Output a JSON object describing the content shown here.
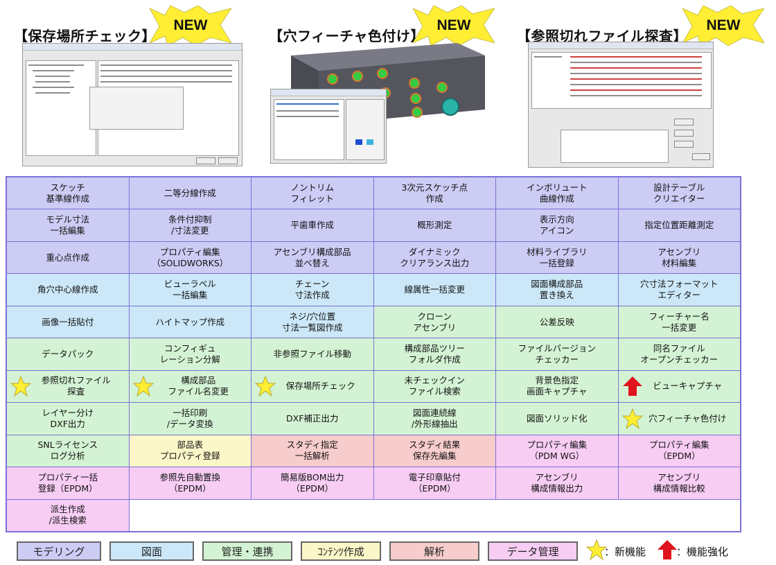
{
  "features": [
    {
      "title": "【保存場所チェック】",
      "badge": "NEW"
    },
    {
      "title": "【穴フィーチャ色付け】",
      "badge": "NEW"
    },
    {
      "title": "【参照切れファイル探査】",
      "badge": "NEW"
    }
  ],
  "cells": [
    {
      "label": "スケッチ\n基準線作成",
      "category": "modeling"
    },
    {
      "label": "二等分線作成",
      "category": "modeling"
    },
    {
      "label": "ノントリム\nフィレット",
      "category": "modeling"
    },
    {
      "label": "3次元スケッチ点\n作成",
      "category": "modeling"
    },
    {
      "label": "インボリュート\n曲線作成",
      "category": "modeling"
    },
    {
      "label": "設計テーブル\nクリエイター",
      "category": "modeling"
    },
    {
      "label": "モデル寸法\n一括編集",
      "category": "modeling"
    },
    {
      "label": "条件付抑制\n/寸法変更",
      "category": "modeling"
    },
    {
      "label": "平歯車作成",
      "category": "modeling"
    },
    {
      "label": "概形測定",
      "category": "modeling"
    },
    {
      "label": "表示方向\nアイコン",
      "category": "modeling"
    },
    {
      "label": "指定位置距離測定",
      "category": "modeling"
    },
    {
      "label": "重心点作成",
      "category": "modeling"
    },
    {
      "label": "プロパティ編集\n（SOLIDWORKS）",
      "category": "modeling"
    },
    {
      "label": "アセンブリ構成部品\n並べ替え",
      "category": "modeling"
    },
    {
      "label": "ダイナミック\nクリアランス出力",
      "category": "modeling"
    },
    {
      "label": "材料ライブラリ\n一括登録",
      "category": "modeling"
    },
    {
      "label": "アセンブリ\n材料編集",
      "category": "modeling"
    },
    {
      "label": "角穴中心線作成",
      "category": "drawing"
    },
    {
      "label": "ビューラベル\n一括編集",
      "category": "drawing"
    },
    {
      "label": "チェーン\n寸法作成",
      "category": "drawing"
    },
    {
      "label": "線属性一括変更",
      "category": "drawing"
    },
    {
      "label": "図面構成部品\n置き換え",
      "category": "drawing"
    },
    {
      "label": "穴寸法フォーマット\nエディター",
      "category": "drawing"
    },
    {
      "label": "画像一括貼付",
      "category": "drawing"
    },
    {
      "label": "ハイトマップ作成",
      "category": "drawing"
    },
    {
      "label": "ネジ/穴位置\n寸法一覧図作成",
      "category": "drawing"
    },
    {
      "label": "クローン\nアセンブリ",
      "category": "management"
    },
    {
      "label": "公差反映",
      "category": "management"
    },
    {
      "label": "フィーチャー名\n一括変更",
      "category": "management"
    },
    {
      "label": "データパック",
      "category": "management"
    },
    {
      "label": "コンフィギュ\nレーション分解",
      "category": "management"
    },
    {
      "label": "非参照ファイル移動",
      "category": "management"
    },
    {
      "label": "構成部品ツリー\nフォルダ作成",
      "category": "management"
    },
    {
      "label": "ファイルバージョン\nチェッカー",
      "category": "management"
    },
    {
      "label": "同名ファイル\nオープンチェッカー",
      "category": "management"
    },
    {
      "label": "参照切れファイル\n探査",
      "category": "management",
      "icon": "star"
    },
    {
      "label": "構成部品\nファイル名変更",
      "category": "management",
      "icon": "star"
    },
    {
      "label": "保存場所チェック",
      "category": "management",
      "icon": "star"
    },
    {
      "label": "未チェックイン\nファイル検索",
      "category": "management"
    },
    {
      "label": "背景色指定\n画面キャプチャ",
      "category": "management"
    },
    {
      "label": "ビューキャプチャ",
      "category": "management",
      "icon": "arrow"
    },
    {
      "label": "レイヤー分け\nDXF出力",
      "category": "management"
    },
    {
      "label": "一括印刷\n/データ変換",
      "category": "management"
    },
    {
      "label": "DXF補正出力",
      "category": "management"
    },
    {
      "label": "図面連続線\n/外形線抽出",
      "category": "management"
    },
    {
      "label": "図面ソリッド化",
      "category": "management"
    },
    {
      "label": "穴フィーチャ色付け",
      "category": "management",
      "icon": "star"
    },
    {
      "label": "SNLライセンス\nログ分析",
      "category": "management"
    },
    {
      "label": "部品表\nプロパティ登録",
      "category": "content"
    },
    {
      "label": "スタディ指定\n一括解析",
      "category": "analysis"
    },
    {
      "label": "スタディ結果\n保存先編集",
      "category": "analysis"
    },
    {
      "label": "プロパティ編集\n（PDM WG）",
      "category": "data"
    },
    {
      "label": "プロパティ編集\n（EPDM）",
      "category": "data"
    },
    {
      "label": "プロパティ一括\n登録（EPDM）",
      "category": "data"
    },
    {
      "label": "参照先自動置換\n（EPDM）",
      "category": "data"
    },
    {
      "label": "簡易版BOM出力\n（EPDM）",
      "category": "data"
    },
    {
      "label": "電子印章貼付\n（EPDM）",
      "category": "data"
    },
    {
      "label": "アセンブリ\n構成情報出力",
      "category": "data"
    },
    {
      "label": "アセンブリ\n構成情報比較",
      "category": "data"
    },
    {
      "label": "派生作成\n/派生検索",
      "category": "data"
    }
  ],
  "legend": {
    "categories": [
      {
        "label": "モデリング",
        "color": "#ccccf5"
      },
      {
        "label": "図面",
        "color": "#cce8f8"
      },
      {
        "label": "管理・連携",
        "color": "#d4f3d4"
      },
      {
        "label": "ｺﾝﾃﾝﾂ作成",
        "color": "#fbf7c8"
      },
      {
        "label": "解析",
        "color": "#f7cccc"
      },
      {
        "label": "データ管理",
        "color": "#f7cdf4"
      }
    ],
    "new_feature": "：新機能",
    "enhanced": "：機能強化"
  },
  "colors": {
    "grid_border": "#7b6fd6",
    "star": "#ffee33",
    "arrow": "#e0141e",
    "badge": "#ffee33"
  }
}
